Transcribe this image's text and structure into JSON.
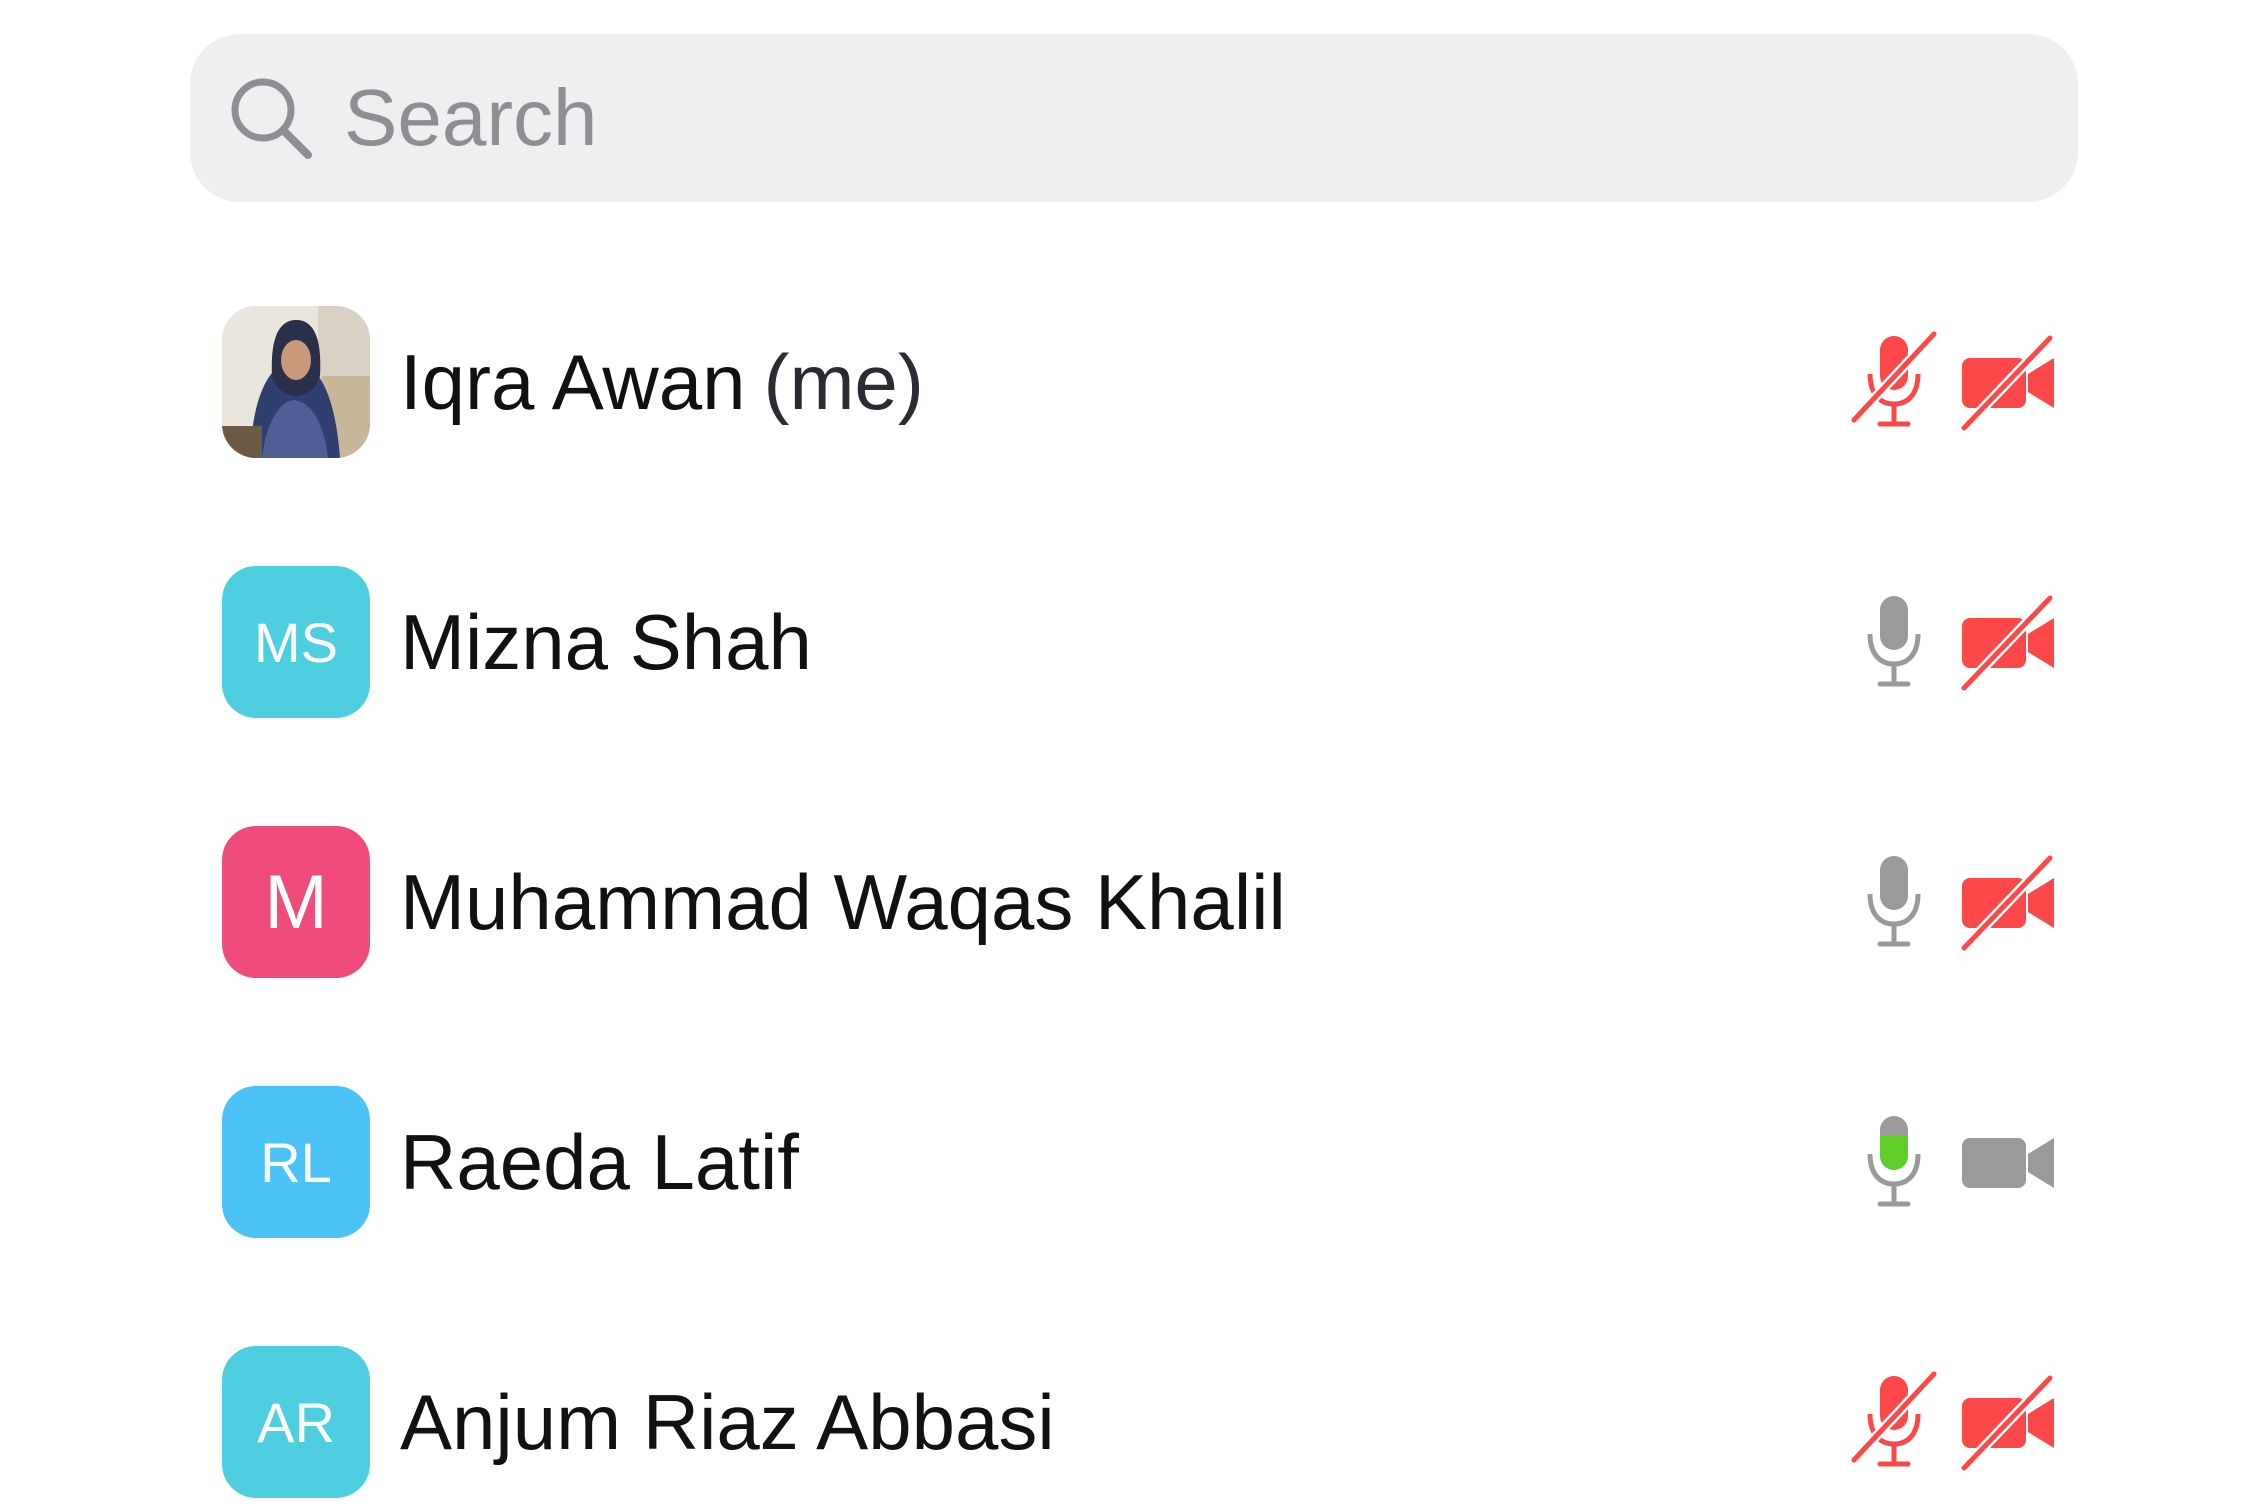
{
  "search": {
    "placeholder": "Search",
    "value": ""
  },
  "colors": {
    "muted_red": "#fc4848",
    "neutral_gray": "#9a9a9a",
    "speaking_green": "#5fce2a",
    "search_bg": "#efeff1"
  },
  "participants": [
    {
      "name": "Iqra Awan",
      "me_label": "(me)",
      "avatar_type": "photo",
      "initials": "",
      "avatar_color": "",
      "mic_status": "muted",
      "video_status": "off"
    },
    {
      "name": "Mizna Shah",
      "avatar_type": "initials",
      "initials": "MS",
      "avatar_color": "#4dcfe0",
      "mic_status": "unmuted",
      "video_status": "off"
    },
    {
      "name": "Muhammad Waqas Khalil",
      "avatar_type": "initials",
      "initials": "M",
      "avatar_color": "#ef4b7b",
      "mic_status": "unmuted",
      "video_status": "off"
    },
    {
      "name": "Raeda Latif",
      "avatar_type": "initials",
      "initials": "RL",
      "avatar_color": "#4bc3f6",
      "mic_status": "speaking",
      "video_status": "on"
    },
    {
      "name": "Anjum Riaz Abbasi",
      "avatar_type": "initials",
      "initials": "AR",
      "avatar_color": "#4dcfe0",
      "mic_status": "muted",
      "video_status": "off"
    }
  ]
}
